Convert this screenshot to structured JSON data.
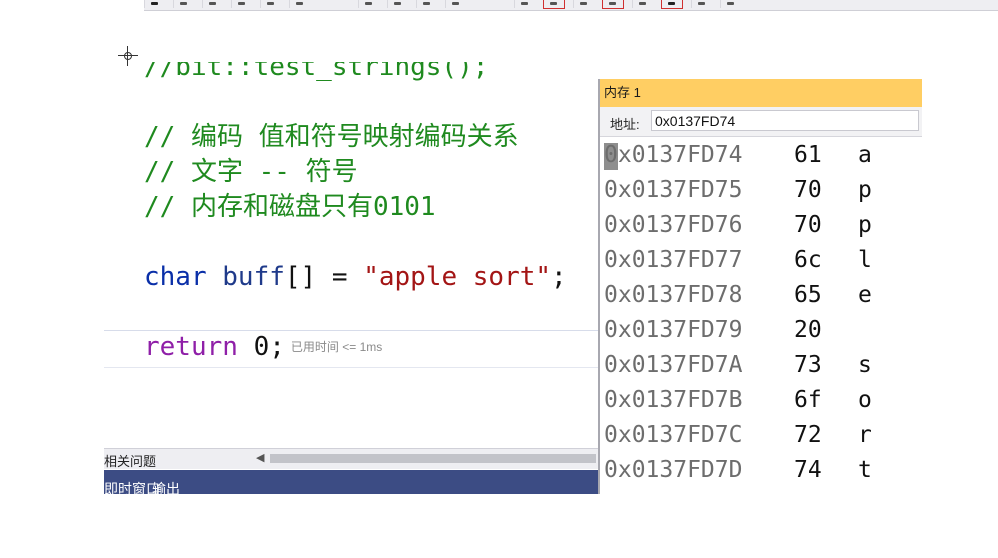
{
  "editor": {
    "partial_line": "//bit::test_strings();",
    "comments": [
      "// 编码 值和符号映射编码关系",
      "// 文字 -- 符号",
      "// 内存和磁盘只有0101"
    ],
    "decl": {
      "type": "char",
      "name": "buff",
      "brackets": "[]",
      "op": "=",
      "value": "\"apple sort\"",
      "end": ";"
    },
    "ret": {
      "keyword": "return",
      "value": "0;",
      "hint": "已用时间 <= 1ms"
    }
  },
  "bottom": {
    "panel_label": "相关问题",
    "tabs": [
      "即时窗口",
      "输出"
    ]
  },
  "memory_window": {
    "title": "内存 1",
    "address_label": "地址:",
    "address_value": "0x0137FD74",
    "rows": [
      {
        "addr": "0x0137FD74",
        "hex": "61",
        "char": "a"
      },
      {
        "addr": "0x0137FD75",
        "hex": "70",
        "char": "p"
      },
      {
        "addr": "0x0137FD76",
        "hex": "70",
        "char": "p"
      },
      {
        "addr": "0x0137FD77",
        "hex": "6c",
        "char": "l"
      },
      {
        "addr": "0x0137FD78",
        "hex": "65",
        "char": "e"
      },
      {
        "addr": "0x0137FD79",
        "hex": "20",
        "char": ""
      },
      {
        "addr": "0x0137FD7A",
        "hex": "73",
        "char": "s"
      },
      {
        "addr": "0x0137FD7B",
        "hex": "6f",
        "char": "o"
      },
      {
        "addr": "0x0137FD7C",
        "hex": "72",
        "char": "r"
      },
      {
        "addr": "0x0137FD7D",
        "hex": "74",
        "char": "t"
      }
    ]
  },
  "colors": {
    "memory_title_bg": "#ffce63",
    "tabbar_bg": "#3c4c84",
    "comment": "#1f8a1f",
    "string": "#a31515",
    "keyword": "#0a2fa8"
  }
}
